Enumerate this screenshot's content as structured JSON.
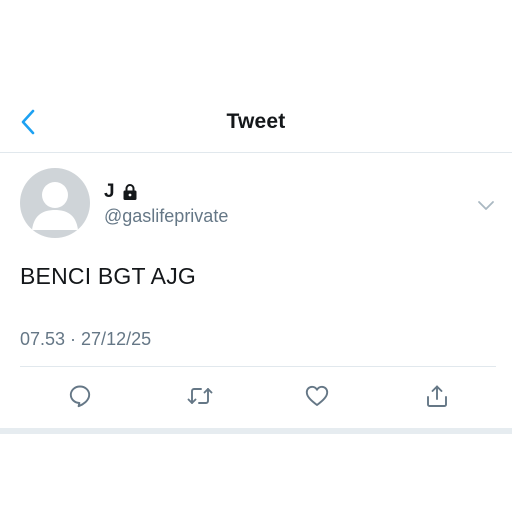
{
  "nav": {
    "back_icon": "chevron-left-icon",
    "title": "Tweet"
  },
  "tweet": {
    "display_name": "J",
    "lock_icon": "lock-icon",
    "handle": "@gaslifeprivate",
    "text": "BENCI BGT AJG",
    "timestamp": "07.53 · 27/12/25",
    "caret_icon": "chevron-down-icon"
  },
  "actions": [
    {
      "name": "reply",
      "icon": "comment-icon"
    },
    {
      "name": "retweet",
      "icon": "retweet-icon"
    },
    {
      "name": "like",
      "icon": "heart-icon"
    },
    {
      "name": "share",
      "icon": "share-icon"
    }
  ],
  "colors": {
    "accent": "#1da1f2",
    "text_primary": "#14171a",
    "text_secondary": "#657786",
    "divider": "#e1e8ed",
    "avatar_bg": "#cfd4d8",
    "icon": "#657786"
  }
}
